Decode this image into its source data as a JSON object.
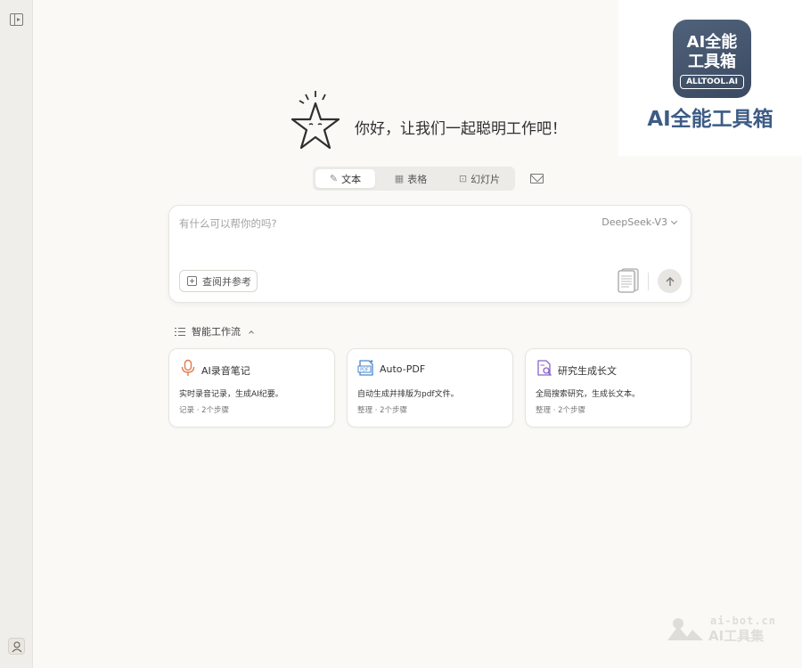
{
  "brand": {
    "logo_line1": "AI全能",
    "logo_line2": "工具箱",
    "logo_badge": "ALLTOOL.AI",
    "name": "AI全能工具箱"
  },
  "hero": {
    "greeting": "你好，让我们一起聪明工作吧！"
  },
  "modes": [
    {
      "label": "文本",
      "icon": "text-edit-icon",
      "active": true
    },
    {
      "label": "表格",
      "icon": "table-icon",
      "active": false
    },
    {
      "label": "幻灯片",
      "icon": "slides-icon",
      "active": false
    }
  ],
  "prompt": {
    "placeholder": "有什么可以帮你的吗?",
    "value": "",
    "model": "DeepSeek-V3",
    "reference_label": "查阅并参考"
  },
  "workflow": {
    "title": "智能工作流",
    "cards": [
      {
        "title": "AI录音笔记",
        "desc": "实时录音记录，生成AI纪要。",
        "tag": "记录",
        "steps": "2个步骤",
        "icon": "microphone-icon",
        "color": "#e07a4f"
      },
      {
        "title": "Auto-PDF",
        "desc": "自动生成并排版为pdf文件。",
        "tag": "整理",
        "steps": "2个步骤",
        "icon": "pdf-file-icon",
        "color": "#4a86c8"
      },
      {
        "title": "研究生成长文",
        "desc": "全局搜索研究，生成长文本。",
        "tag": "整理",
        "steps": "2个步骤",
        "icon": "document-search-icon",
        "color": "#8a64c8"
      }
    ],
    "meta_separator": "·"
  },
  "watermark": {
    "site": "ai-bot.cn",
    "name": "AI工具集"
  }
}
